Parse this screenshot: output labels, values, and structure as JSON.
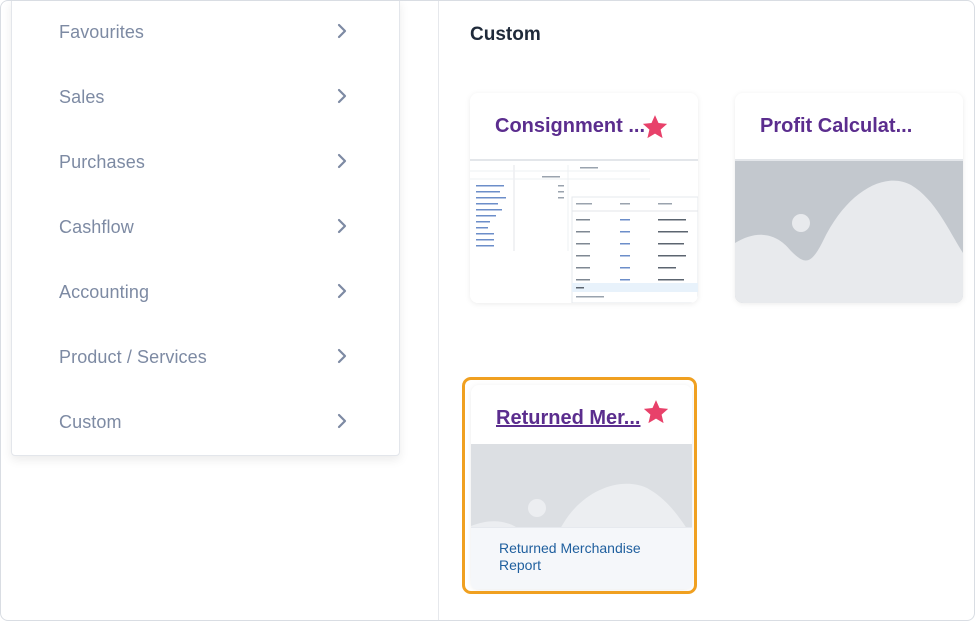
{
  "sidebar": {
    "items": [
      {
        "label": "Favourites"
      },
      {
        "label": "Sales"
      },
      {
        "label": "Purchases"
      },
      {
        "label": "Cashflow"
      },
      {
        "label": "Accounting"
      },
      {
        "label": "Product / Services"
      },
      {
        "label": "Custom"
      }
    ]
  },
  "section": {
    "title": "Custom"
  },
  "cards": [
    {
      "title": "Consignment ...",
      "starred": true
    },
    {
      "title": "Profit Calculat...",
      "starred": false
    },
    {
      "title": "Returned Mer...",
      "starred": true
    }
  ],
  "tooltip": {
    "text": "Returned Merchandise Report"
  },
  "colors": {
    "accent_purple": "#5b2d8e",
    "star": "#e8416a",
    "highlight": "#f0a020",
    "link_blue": "#1f5f9e",
    "sidebar_text": "#7d8aa3"
  }
}
